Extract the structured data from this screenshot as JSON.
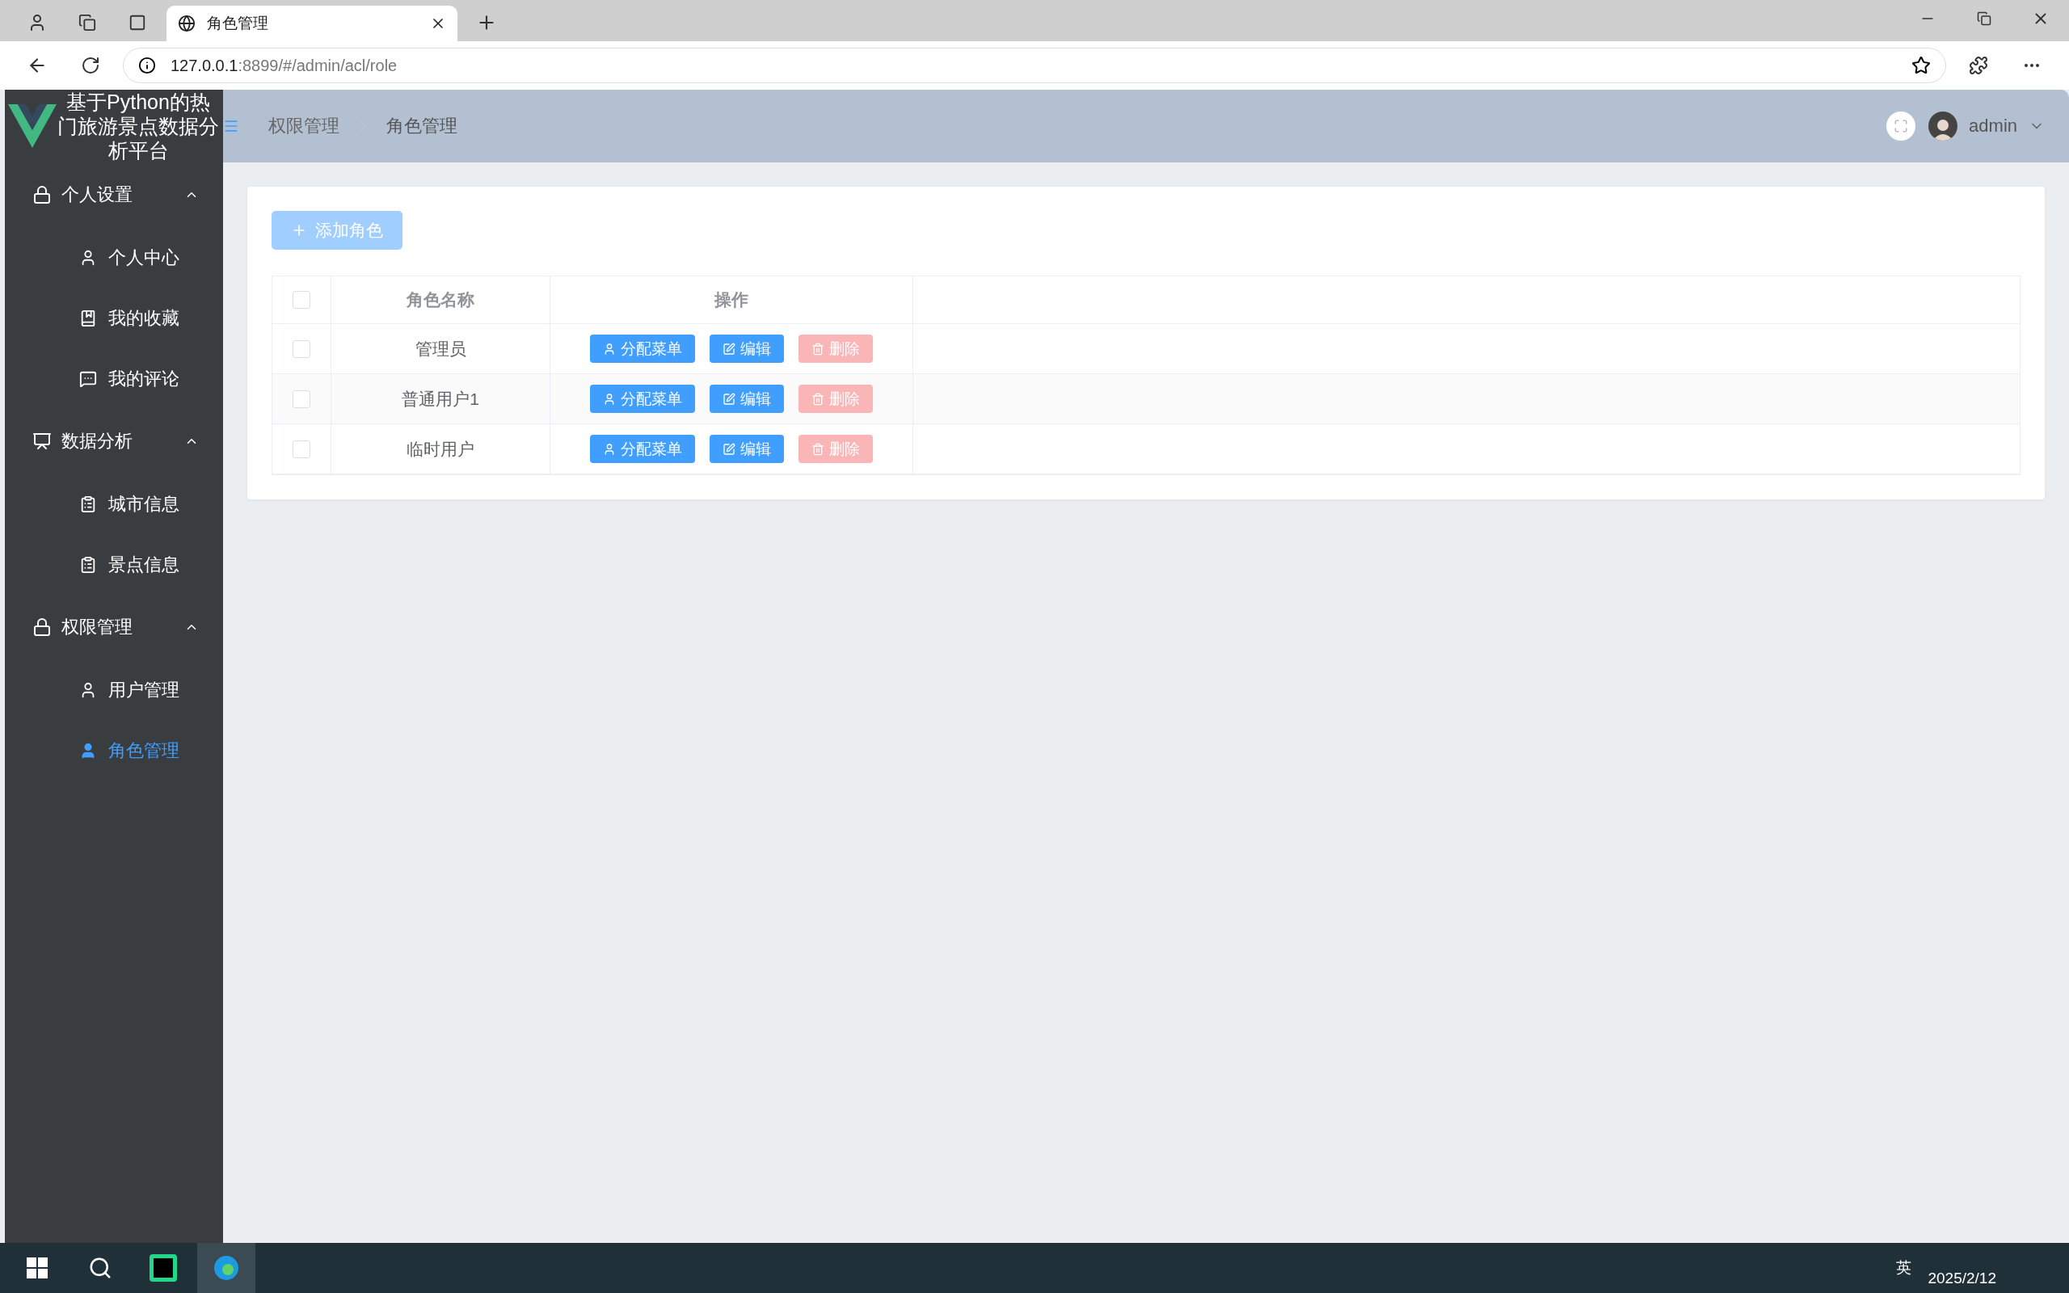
{
  "browser": {
    "tabs": [
      {
        "title": "角色管理",
        "selected": true
      }
    ],
    "url": {
      "host": "127.0.0.1",
      "path": ":8899/#/admin/acl/role"
    }
  },
  "sidebar": {
    "title": "基于Python的热门旅游景点数据分析平台",
    "groups": [
      {
        "label": "个人设置",
        "expanded": true,
        "items": [
          {
            "label": "个人中心",
            "selected": false
          },
          {
            "label": "我的收藏",
            "selected": false
          },
          {
            "label": "我的评论",
            "selected": false
          }
        ]
      },
      {
        "label": "数据分析",
        "expanded": true,
        "items": [
          {
            "label": "城市信息",
            "selected": false
          },
          {
            "label": "景点信息",
            "selected": false
          }
        ]
      },
      {
        "label": "权限管理",
        "expanded": true,
        "items": [
          {
            "label": "用户管理",
            "selected": false
          },
          {
            "label": "角色管理",
            "selected": true
          }
        ]
      }
    ]
  },
  "header": {
    "breadcrumb": [
      "权限管理",
      "角色管理"
    ],
    "user": "admin"
  },
  "toolbar": {
    "add_button": {
      "label": "添加角色",
      "disabled": true
    }
  },
  "table": {
    "select_all": false,
    "columns": [
      "角色名称",
      "操作"
    ],
    "rows": [
      {
        "checked": false,
        "name": "管理员",
        "actions": [
          {
            "kind": "assign",
            "label": "分配菜单",
            "disabled": false
          },
          {
            "kind": "edit",
            "label": "编辑",
            "disabled": false
          },
          {
            "kind": "delete",
            "label": "删除",
            "disabled": true
          }
        ]
      },
      {
        "checked": false,
        "name": "普通用户1",
        "actions": [
          {
            "kind": "assign",
            "label": "分配菜单",
            "disabled": false
          },
          {
            "kind": "edit",
            "label": "编辑",
            "disabled": false
          },
          {
            "kind": "delete",
            "label": "删除",
            "disabled": true
          }
        ]
      },
      {
        "checked": false,
        "name": "临时用户",
        "actions": [
          {
            "kind": "assign",
            "label": "分配菜单",
            "disabled": false
          },
          {
            "kind": "edit",
            "label": "编辑",
            "disabled": false
          },
          {
            "kind": "delete",
            "label": "删除",
            "disabled": true
          }
        ]
      }
    ]
  },
  "taskbar": {
    "ime": "英",
    "date": "2025/2/12"
  }
}
